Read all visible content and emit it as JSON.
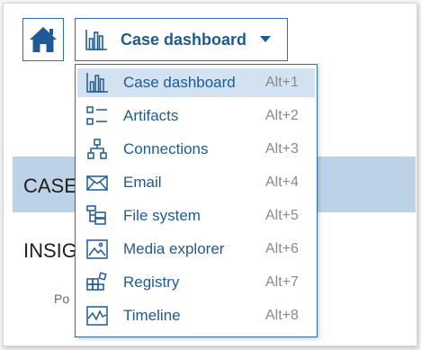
{
  "colors": {
    "accent": "#1f5a93",
    "border": "#2f6dac",
    "highlight": "#d3e2f0",
    "shortcut": "#8a8a8a",
    "band": "#bcd3e7"
  },
  "header": {
    "home_icon": "home-icon",
    "view_selector": {
      "icon": "bar-chart-icon",
      "label": "Case dashboard",
      "dropdown_icon": "caret-down-icon"
    }
  },
  "background": {
    "section_heading": "CASE",
    "insights_heading": "INSIG",
    "partial_text": "Po"
  },
  "menu": {
    "items": [
      {
        "label": "Case dashboard",
        "shortcut": "Alt+1",
        "icon": "bar-chart-icon",
        "highlighted": true
      },
      {
        "label": "Artifacts",
        "shortcut": "Alt+2",
        "icon": "list-icon",
        "highlighted": false
      },
      {
        "label": "Connections",
        "shortcut": "Alt+3",
        "icon": "network-icon",
        "highlighted": false
      },
      {
        "label": "Email",
        "shortcut": "Alt+4",
        "icon": "envelope-icon",
        "highlighted": false
      },
      {
        "label": "File system",
        "shortcut": "Alt+5",
        "icon": "folder-tree-icon",
        "highlighted": false
      },
      {
        "label": "Media explorer",
        "shortcut": "Alt+6",
        "icon": "image-icon",
        "highlighted": false
      },
      {
        "label": "Registry",
        "shortcut": "Alt+7",
        "icon": "registry-icon",
        "highlighted": false
      },
      {
        "label": "Timeline",
        "shortcut": "Alt+8",
        "icon": "timeline-icon",
        "highlighted": false
      }
    ]
  }
}
